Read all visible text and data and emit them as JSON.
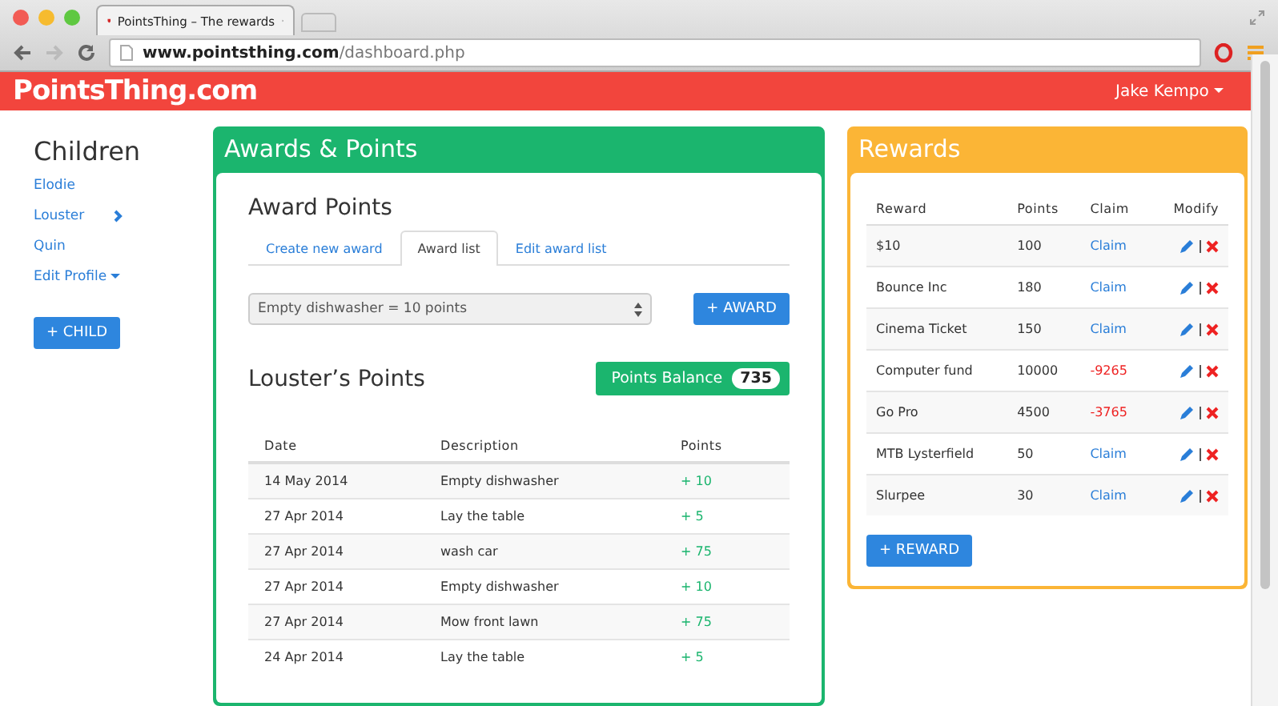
{
  "browser": {
    "tab_title": "PointsThing – The rewards",
    "url_host": "www.pointsthing.com",
    "url_path": "/dashboard.php"
  },
  "navbar": {
    "brand": "PointsThing.com",
    "user": "Jake Kempo"
  },
  "sidebar": {
    "title": "Children",
    "children": [
      {
        "label": "Elodie",
        "selected": false
      },
      {
        "label": "Louster",
        "selected": true
      },
      {
        "label": "Quin",
        "selected": false
      }
    ],
    "edit_profile": "Edit Profile",
    "add_button": "+ CHILD"
  },
  "awards": {
    "panel_title": "Awards & Points",
    "section_title": "Award Points",
    "tabs": [
      {
        "label": "Create new award",
        "selected": false
      },
      {
        "label": "Award list",
        "selected": true
      },
      {
        "label": "Edit award list",
        "selected": false
      }
    ],
    "select_value": "Empty dishwasher = 10 points",
    "award_button": "+ AWARD",
    "points_title": "Louster’s Points",
    "balance_label": "Points Balance",
    "balance_value": "735",
    "columns": [
      "Date",
      "Description",
      "Points"
    ],
    "rows": [
      {
        "date": "14 May 2014",
        "description": "Empty dishwasher",
        "points": "+ 10"
      },
      {
        "date": "27 Apr 2014",
        "description": "Lay the table",
        "points": "+ 5"
      },
      {
        "date": "27 Apr 2014",
        "description": "wash car",
        "points": "+ 75"
      },
      {
        "date": "27 Apr 2014",
        "description": "Empty dishwasher",
        "points": "+ 10"
      },
      {
        "date": "27 Apr 2014",
        "description": "Mow front lawn",
        "points": "+ 75"
      },
      {
        "date": "24 Apr 2014",
        "description": "Lay the table",
        "points": "+ 5"
      }
    ]
  },
  "rewards": {
    "panel_title": "Rewards",
    "columns": [
      "Reward",
      "Points",
      "Claim",
      "Modify"
    ],
    "rows": [
      {
        "reward": "$10",
        "points": "100",
        "claim": "Claim",
        "claimable": true
      },
      {
        "reward": "Bounce Inc",
        "points": "180",
        "claim": "Claim",
        "claimable": true
      },
      {
        "reward": "Cinema Ticket",
        "points": "150",
        "claim": "Claim",
        "claimable": true
      },
      {
        "reward": "Computer fund",
        "points": "10000",
        "claim": "-9265",
        "claimable": false
      },
      {
        "reward": "Go Pro",
        "points": "4500",
        "claim": "-3765",
        "claimable": false
      },
      {
        "reward": "MTB Lysterfield",
        "points": "50",
        "claim": "Claim",
        "claimable": true
      },
      {
        "reward": "Slurpee",
        "points": "30",
        "claim": "Claim",
        "claimable": true
      }
    ],
    "add_button": "+ REWARD"
  }
}
